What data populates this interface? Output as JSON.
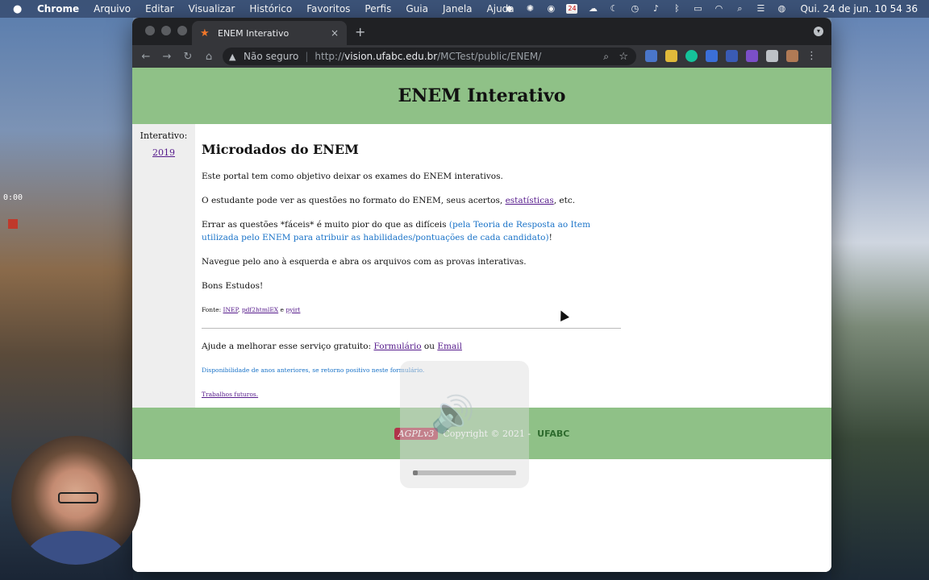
{
  "menubar": {
    "apple": "",
    "items": [
      "Chrome",
      "Arquivo",
      "Editar",
      "Visualizar",
      "Histórico",
      "Favoritos",
      "Perfis",
      "Guia",
      "Janela",
      "Ajuda"
    ],
    "calendar_day": "24",
    "clock": "Qui. 24 de jun.  10 54 36"
  },
  "browser": {
    "tab_title": "ENEM Interativo",
    "tab_close": "×",
    "new_tab": "+",
    "not_secure": "Não seguro",
    "url_scheme": "http://",
    "url_host": "vision.ufabc.edu.br",
    "url_path": "/MCTest/public/ENEM/"
  },
  "page": {
    "header_title": "ENEM Interativo",
    "sidebar_label": "Interativo:",
    "sidebar_year": "2019",
    "main_title": "Microdados do ENEM",
    "p1": "Este portal tem como objetivo deixar os exames do ENEM interativos.",
    "p2_before": "O estudante pode ver as questões no formato do ENEM, seus acertos, ",
    "p2_link": "estatísticas",
    "p2_after": ", etc.",
    "p3_before": "Errar as questões *fáceis* é muito pior do que as difíceis ",
    "p3_blue": "(pela Teoria de Resposta ao Item utilizada pelo ENEM para atribuir as habilidades/pontuações de cada candidato)",
    "p3_after": "!",
    "p4": "Navegue pelo ano à esquerda e abra os arquivos com as provas interativas.",
    "p5": "Bons Estudos!",
    "fonte_label": "Fonte: ",
    "fonte_link1": "INEP",
    "fonte_sep1": ", ",
    "fonte_link2": "pdf2htmlEX",
    "fonte_sep2": " e ",
    "fonte_link3": "pyirt",
    "help_before": "Ajude a melhorar esse serviço gratuito: ",
    "help_link1": "Formulário",
    "help_mid": " ou ",
    "help_link2": "Email",
    "availability": "Disponibilidade de anos anteriores, se retorno positivo neste formulário.",
    "future_works": "Trabalhos futuros.",
    "footer_agpl": "AGPLv3",
    "footer_copyright": "Copyright © 2021 -",
    "footer_ufabc": "UFABC"
  },
  "overlay": {
    "volume_level": 0.05,
    "recording_time": "0:00"
  },
  "colors": {
    "header_green": "#8fc187",
    "link_visited": "#551a8b",
    "note_blue": "#1a73c8"
  }
}
